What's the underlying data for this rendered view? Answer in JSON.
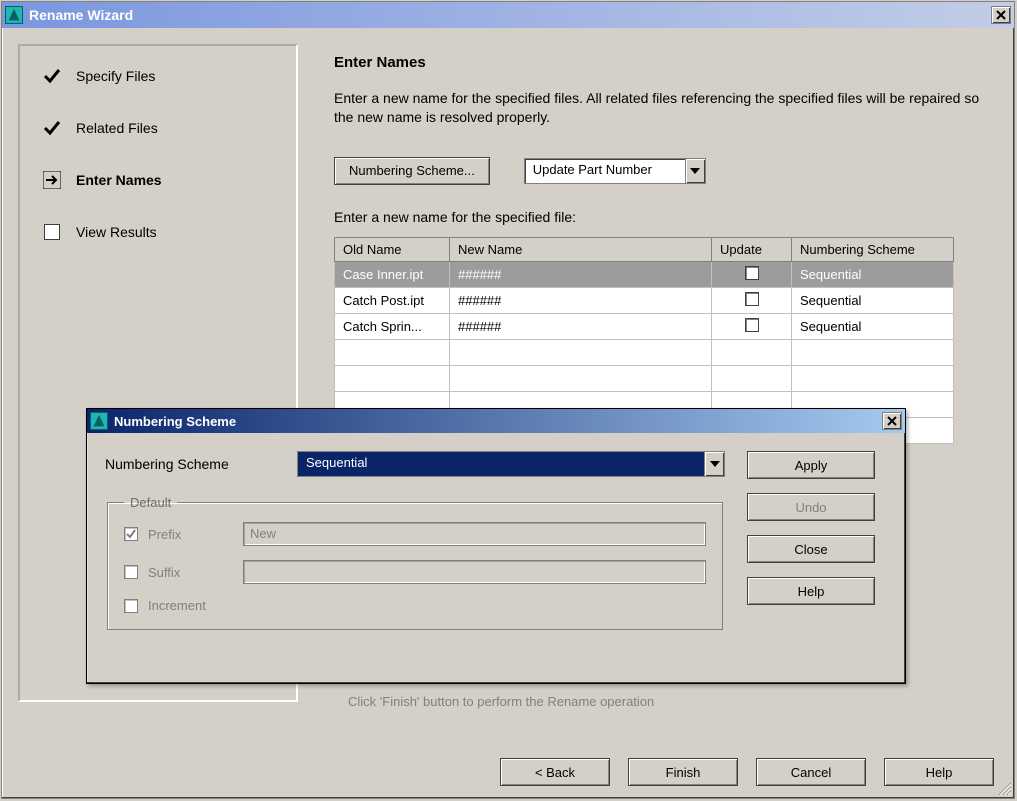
{
  "window": {
    "title": "Rename Wizard",
    "close_tooltip": "Close"
  },
  "steps": [
    {
      "label": "Specify Files",
      "state": "done"
    },
    {
      "label": "Related Files",
      "state": "done"
    },
    {
      "label": "Enter Names",
      "state": "current"
    },
    {
      "label": "View Results",
      "state": "pending"
    }
  ],
  "content": {
    "heading": "Enter Names",
    "description": "Enter a new name for the specified files.  All related files referencing the specified files will be repaired so the new name is resolved properly.",
    "numbering_scheme_button": "Numbering Scheme...",
    "update_dropdown": "Update Part Number",
    "sub_prompt": "Enter a new name for the specified file:",
    "columns": {
      "old": "Old Name",
      "new": "New Name",
      "update": "Update",
      "scheme": "Numbering Scheme"
    },
    "rows": [
      {
        "old": "Case Inner.ipt",
        "new": "######",
        "update": false,
        "scheme": "Sequential",
        "selected": true
      },
      {
        "old": "Catch Post.ipt",
        "new": "######",
        "update": false,
        "scheme": "Sequential",
        "selected": false
      },
      {
        "old": "Catch Sprin...",
        "new": "######",
        "update": false,
        "scheme": "Sequential",
        "selected": false
      }
    ],
    "status_line": "Click 'Finish' button to perform the Rename operation"
  },
  "footer": {
    "back": "< Back",
    "finish": "Finish",
    "cancel": "Cancel",
    "help": "Help"
  },
  "dialog": {
    "title": "Numbering Scheme",
    "label": "Numbering Scheme",
    "dropdown_value": "Sequential",
    "group_title": "Default",
    "options": {
      "prefix_label": "Prefix",
      "prefix_value": "New",
      "prefix_checked": true,
      "suffix_label": "Suffix",
      "suffix_value": "",
      "suffix_checked": false,
      "increment_label": "Increment",
      "increment_checked": false
    },
    "buttons": {
      "apply": "Apply",
      "undo": "Undo",
      "close": "Close",
      "help": "Help"
    }
  }
}
